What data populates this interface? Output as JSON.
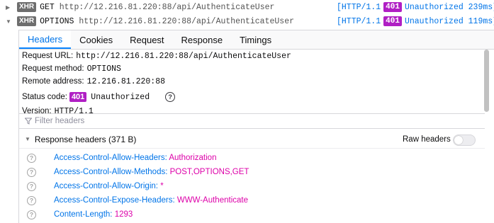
{
  "requests": [
    {
      "expanded": false,
      "type_badge": "XHR",
      "method": "GET",
      "url": "http://12.216.81.220:88/api/AuthenticateUser",
      "protocol": "[HTTP/1.1",
      "status_code": "401",
      "status_text_time": "Unauthorized 239ms]"
    },
    {
      "expanded": true,
      "type_badge": "XHR",
      "method": "OPTIONS",
      "url": "http://12.216.81.220:88/api/AuthenticateUser",
      "protocol": "[HTTP/1.1",
      "status_code": "401",
      "status_text_time": "Unauthorized 119ms]"
    }
  ],
  "tabs": [
    {
      "label": "Headers",
      "active": true
    },
    {
      "label": "Cookies",
      "active": false
    },
    {
      "label": "Request",
      "active": false
    },
    {
      "label": "Response",
      "active": false
    },
    {
      "label": "Timings",
      "active": false
    }
  ],
  "summary": {
    "request_url_label": "Request URL:",
    "request_url": "http://12.216.81.220:88/api/AuthenticateUser",
    "request_method_label": "Request method:",
    "request_method": "OPTIONS",
    "remote_address_label": "Remote address:",
    "remote_address": "12.216.81.220:88",
    "status_code_label": "Status code:",
    "status_code": "401",
    "status_text": "Unauthorized",
    "version_label": "Version:",
    "version": "HTTP/1.1"
  },
  "filter": {
    "placeholder": "Filter headers"
  },
  "response_headers": {
    "title": "Response headers (371 B)",
    "raw_headers_label": "Raw headers",
    "raw_headers_enabled": false,
    "items": [
      {
        "name": "Access-Control-Allow-Headers:",
        "value": "Authorization"
      },
      {
        "name": "Access-Control-Allow-Methods:",
        "value": "POST,OPTIONS,GET"
      },
      {
        "name": "Access-Control-Allow-Origin:",
        "value": "*"
      },
      {
        "name": "Access-Control-Expose-Headers:",
        "value": "WWW-Authenticate"
      },
      {
        "name": "Content-Length:",
        "value": "1293"
      }
    ]
  },
  "colors": {
    "accent_blue": "#0074e8",
    "status_purple": "#b01fc4",
    "header_value_magenta": "#dd00a9"
  },
  "icons": {
    "collapsed_twisty": "triangle-right-icon",
    "expanded_twisty": "triangle-down-icon",
    "help": "question-circle-icon",
    "filter": "funnel-icon"
  }
}
